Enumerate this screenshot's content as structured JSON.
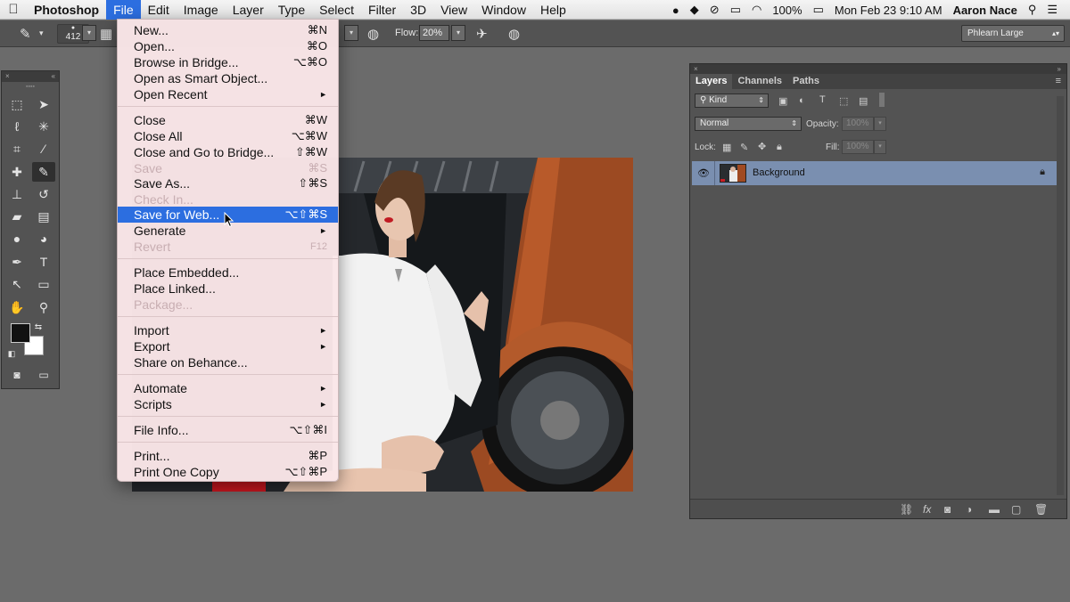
{
  "menubar": {
    "apple": "",
    "app": "Photoshop",
    "items": [
      "File",
      "Edit",
      "Image",
      "Layer",
      "Type",
      "Select",
      "Filter",
      "3D",
      "View",
      "Window",
      "Help"
    ],
    "battery": "100%",
    "datetime": "Mon Feb 23  9:10 AM",
    "user": "Aaron Nace"
  },
  "options_bar": {
    "brush_size": "412",
    "flow_label": "Flow:",
    "flow_value": "20%",
    "workspace": "Phlearn Large"
  },
  "file_menu": {
    "items": [
      {
        "label": "New...",
        "shortcut": "⌘N",
        "disabled": false
      },
      {
        "label": "Open...",
        "shortcut": "⌘O",
        "disabled": false
      },
      {
        "label": "Browse in Bridge...",
        "shortcut": "⌥⌘O",
        "disabled": false
      },
      {
        "label": "Open as Smart Object...",
        "shortcut": "",
        "disabled": false
      },
      {
        "label": "Open Recent",
        "shortcut": "►",
        "disabled": false
      },
      {
        "label": "Close",
        "shortcut": "⌘W",
        "disabled": false
      },
      {
        "label": "Close All",
        "shortcut": "⌥⌘W",
        "disabled": false
      },
      {
        "label": "Close and Go to Bridge...",
        "shortcut": "⇧⌘W",
        "disabled": false
      },
      {
        "label": "Save",
        "shortcut": "⌘S",
        "disabled": true
      },
      {
        "label": "Save As...",
        "shortcut": "⇧⌘S",
        "disabled": false
      },
      {
        "label": "Check In...",
        "shortcut": "",
        "disabled": true
      },
      {
        "label": "Save for Web...",
        "shortcut": "⌥⇧⌘S",
        "disabled": false,
        "highlighted": true
      },
      {
        "label": "Generate",
        "shortcut": "►",
        "disabled": false
      },
      {
        "label": "Revert",
        "shortcut": "F12",
        "disabled": true
      },
      {
        "label": "Place Embedded...",
        "shortcut": "",
        "disabled": false
      },
      {
        "label": "Place Linked...",
        "shortcut": "",
        "disabled": false
      },
      {
        "label": "Package...",
        "shortcut": "",
        "disabled": true
      },
      {
        "label": "Import",
        "shortcut": "►",
        "disabled": false
      },
      {
        "label": "Export",
        "shortcut": "►",
        "disabled": false
      },
      {
        "label": "Share on Behance...",
        "shortcut": "",
        "disabled": false
      },
      {
        "label": "Automate",
        "shortcut": "►",
        "disabled": false
      },
      {
        "label": "Scripts",
        "shortcut": "►",
        "disabled": false
      },
      {
        "label": "File Info...",
        "shortcut": "⌥⇧⌘I",
        "disabled": false
      },
      {
        "label": "Print...",
        "shortcut": "⌘P",
        "disabled": false
      },
      {
        "label": "Print One Copy",
        "shortcut": "⌥⇧⌘P",
        "disabled": false
      }
    ]
  },
  "layers_panel": {
    "tabs": [
      "Layers",
      "Channels",
      "Paths"
    ],
    "kind_label": "Kind",
    "blend_mode": "Normal",
    "opacity_label": "Opacity:",
    "opacity_value": "100%",
    "lock_label": "Lock:",
    "fill_label": "Fill:",
    "fill_value": "100%",
    "layer_name": "Background"
  },
  "colors": {
    "accent": "#2c6ee0",
    "layer_selected": "#7a8fb0",
    "panel_bg": "#535353",
    "workspace_bg": "#6b6b6b"
  }
}
